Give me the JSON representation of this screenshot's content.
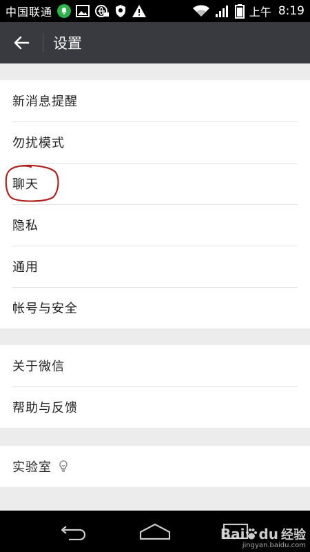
{
  "status_bar": {
    "carrier": "中国联通",
    "time_prefix": "上午",
    "time": "8:19",
    "icons": [
      "notification-bell-icon",
      "image-icon",
      "vpn-icon",
      "shield-icon",
      "warning-icon",
      "wifi-icon",
      "signal-icon",
      "battery-icon"
    ]
  },
  "toolbar": {
    "back_icon": "arrow-left-icon",
    "title": "设置"
  },
  "groups": [
    {
      "items": [
        {
          "label": "新消息提醒"
        },
        {
          "label": "勿扰模式"
        },
        {
          "label": "聊天"
        },
        {
          "label": "隐私"
        },
        {
          "label": "通用"
        },
        {
          "label": "帐号与安全"
        }
      ]
    },
    {
      "items": [
        {
          "label": "关于微信"
        },
        {
          "label": "帮助与反馈"
        }
      ]
    },
    {
      "items": [
        {
          "label": "实验室",
          "icon": "lightbulb-icon"
        }
      ]
    }
  ],
  "annotation": {
    "color": "#b0221e",
    "target": "聊天"
  },
  "nav_bar": {
    "icons": [
      "back-nav-icon",
      "home-nav-icon",
      "recents-nav-icon"
    ]
  },
  "watermark": {
    "brand": "Bai",
    "brand2": "du",
    "suffix": "经验",
    "url": "jingyan.baidu.com"
  }
}
